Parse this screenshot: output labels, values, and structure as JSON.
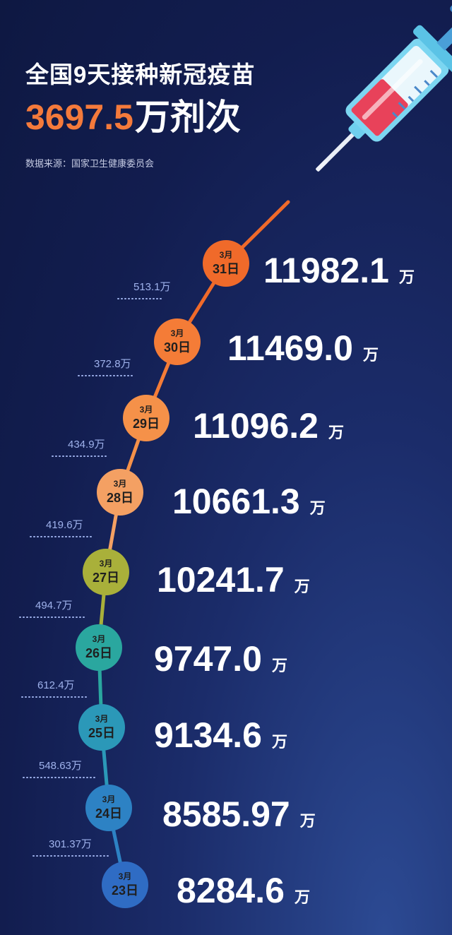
{
  "header": {
    "title": "全国9天接种新冠疫苗",
    "total_value": "3697.5",
    "total_unit": "万剂次",
    "source": "数据来源：国家卫生健康委员会"
  },
  "colors": {
    "accent": "#f47a3b",
    "increment_text": "#9fb2ec"
  },
  "chart_data": {
    "type": "line",
    "unit": "万",
    "month_label": "3月",
    "points": [
      {
        "day": "23日",
        "value": "8284.6",
        "increment": "301.37万",
        "color": "#2f6cc4"
      },
      {
        "day": "24日",
        "value": "8585.97",
        "increment": "548.63万",
        "color": "#2d82c4"
      },
      {
        "day": "25日",
        "value": "9134.6",
        "increment": "612.4万",
        "color": "#2b98b8"
      },
      {
        "day": "26日",
        "value": "9747.0",
        "increment": "494.7万",
        "color": "#2aa79f"
      },
      {
        "day": "27日",
        "value": "10241.7",
        "increment": "419.6万",
        "color": "#a9b03a"
      },
      {
        "day": "28日",
        "value": "10661.3",
        "increment": "434.9万",
        "color": "#f4a063"
      },
      {
        "day": "29日",
        "value": "11096.2",
        "increment": "372.8万",
        "color": "#f59149"
      },
      {
        "day": "30日",
        "value": "11469.0",
        "increment": "513.1万",
        "color": "#f47c37"
      },
      {
        "day": "31日",
        "value": "11982.1",
        "increment": null,
        "color": "#f06a2a"
      }
    ]
  }
}
